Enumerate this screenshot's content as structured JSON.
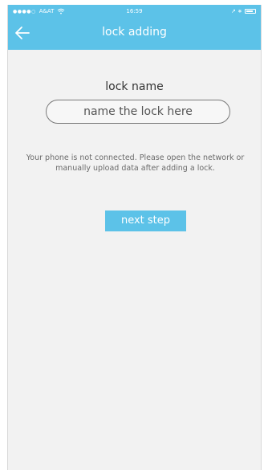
{
  "status_bar": {
    "signal": "●●●●○",
    "carrier": "A&AT",
    "time": "16:59",
    "right_icons": "↗ ∗",
    "battery_level": 0.8
  },
  "nav": {
    "back_icon": "arrow-left-icon",
    "title": "lock adding"
  },
  "form": {
    "lock_name_label": "lock name",
    "lock_name_placeholder": "name the lock here",
    "lock_name_value": ""
  },
  "notice": "Your phone is not connected. Please open the network or manually upload data after adding a lock.",
  "next_button_label": "next step",
  "colors": {
    "accent": "#5cc2e8",
    "background": "#f2f2f2",
    "text": "#333333",
    "muted": "#6a6a6a"
  }
}
